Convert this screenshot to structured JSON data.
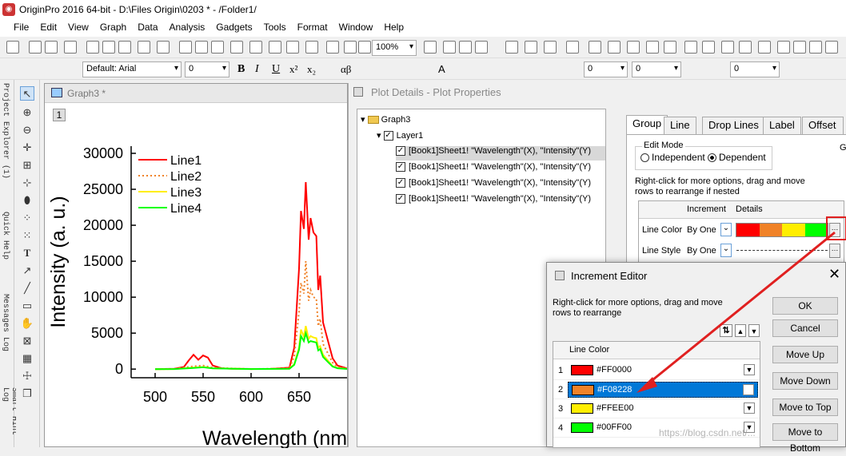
{
  "titlebar": {
    "text": "OriginPro 2016 64-bit - D:\\Files Origin\\0203 * - /Folder1/"
  },
  "menu": [
    "File",
    "Edit",
    "View",
    "Graph",
    "Data",
    "Analysis",
    "Gadgets",
    "Tools",
    "Format",
    "Window",
    "Help"
  ],
  "toolbar": {
    "zoom": "100%",
    "font": "Default: Arial",
    "font_size": "0",
    "size2": "0",
    "size3": "0",
    "size4": "0"
  },
  "side": {
    "project_explorer": "Project Explorer (1)",
    "quick_help": "Quick Help",
    "messages_log": "Messages Log",
    "smart_hint": "Smart Hint Log"
  },
  "graph": {
    "title": "Graph3 *",
    "layer_num": "1"
  },
  "chart_data": {
    "type": "line",
    "xlabel": "Wavelength (nm)",
    "ylabel": "Intensity (a. u.)",
    "xlim": [
      475,
      700
    ],
    "ylim": [
      -1200,
      31000
    ],
    "xticks": [
      "500",
      "550",
      "600",
      "650"
    ],
    "yticks": [
      "0",
      "5000",
      "10000",
      "15000",
      "20000",
      "25000",
      "30000"
    ],
    "series": [
      {
        "name": "Line1",
        "color": "#FF0000",
        "dash": "",
        "x": [
          500,
          520,
          530,
          535,
          540,
          545,
          550,
          555,
          560,
          570,
          580,
          600,
          620,
          640,
          645,
          650,
          652,
          655,
          657,
          660,
          662,
          665,
          668,
          670,
          672,
          675,
          680,
          685,
          690,
          700
        ],
        "y": [
          0,
          50,
          300,
          1200,
          2000,
          1300,
          1900,
          1600,
          500,
          100,
          50,
          20,
          30,
          200,
          3000,
          14000,
          22000,
          19500,
          26000,
          18000,
          21000,
          19000,
          18500,
          11000,
          13000,
          6500,
          4000,
          1500,
          500,
          100
        ]
      },
      {
        "name": "Line2",
        "color": "#F08228",
        "dash": "2,3",
        "x": [
          500,
          520,
          540,
          550,
          560,
          600,
          640,
          645,
          650,
          652,
          655,
          657,
          660,
          662,
          665,
          668,
          670,
          672,
          675,
          680,
          685,
          690,
          700
        ],
        "y": [
          0,
          20,
          400,
          500,
          200,
          10,
          100,
          1800,
          8000,
          12000,
          10500,
          15000,
          9500,
          11000,
          10000,
          9800,
          6000,
          7000,
          3500,
          2200,
          900,
          300,
          50
        ]
      },
      {
        "name": "Line3",
        "color": "#FFEE00",
        "dash": "",
        "x": [
          500,
          520,
          540,
          550,
          560,
          600,
          640,
          645,
          650,
          652,
          655,
          657,
          660,
          662,
          665,
          668,
          670,
          672,
          675,
          680,
          685,
          690,
          700
        ],
        "y": [
          0,
          10,
          200,
          300,
          120,
          5,
          50,
          700,
          3000,
          5500,
          4500,
          6000,
          4200,
          4600,
          4400,
          4300,
          3000,
          3200,
          2000,
          1200,
          400,
          150,
          30
        ]
      },
      {
        "name": "Line4",
        "color": "#00FF00",
        "dash": "",
        "x": [
          500,
          520,
          540,
          550,
          560,
          600,
          640,
          645,
          650,
          652,
          655,
          657,
          660,
          662,
          665,
          668,
          670,
          672,
          675,
          680,
          685,
          690,
          700
        ],
        "y": [
          0,
          8,
          150,
          250,
          100,
          5,
          40,
          600,
          2700,
          4600,
          3900,
          5000,
          3700,
          3900,
          3800,
          3700,
          2600,
          2800,
          1700,
          1000,
          350,
          120,
          20
        ]
      }
    ]
  },
  "plotdetails": {
    "title": "Plot Details - Plot Properties",
    "tree": {
      "root": "Graph3",
      "layer": "Layer1",
      "plots": [
        "[Book1]Sheet1! \"Wavelength\"(X), \"Intensity\"(Y)",
        "[Book1]Sheet1! \"Wavelength\"(X), \"Intensity\"(Y)",
        "[Book1]Sheet1! \"Wavelength\"(X), \"Intensity\"(Y)",
        "[Book1]Sheet1! \"Wavelength\"(X), \"Intensity\"(Y)"
      ]
    },
    "tabs": [
      "Group",
      "Line",
      "Drop Lines",
      "Label",
      "Offset"
    ],
    "edit_mode": {
      "label": "Edit Mode",
      "independent": "Independent",
      "dependent": "Dependent"
    },
    "hint": "Right-click for more options, drag and move rows to  rearrange if nested",
    "table": {
      "col_increment": "Increment",
      "col_details": "Details",
      "rows": [
        {
          "name": "Line Color",
          "increment": "By One"
        },
        {
          "name": "Line Style",
          "increment": "By One"
        }
      ]
    },
    "cut_letter": "G"
  },
  "increment_editor": {
    "title": "Increment Editor",
    "hint": "Right-click for more options, drag and move rows to  rearrange",
    "col_header": "Line Color",
    "rows": [
      {
        "num": "1",
        "hex": "#FF0000",
        "color": "#FF0000"
      },
      {
        "num": "2",
        "hex": "#F08228",
        "color": "#F08228"
      },
      {
        "num": "3",
        "hex": "#FFEE00",
        "color": "#FFEE00"
      },
      {
        "num": "4",
        "hex": "#00FF00",
        "color": "#00FF00"
      }
    ],
    "buttons": {
      "ok": "OK",
      "cancel": "Cancel",
      "move_up": "Move Up",
      "move_down": "Move Down",
      "move_top": "Move to Top",
      "move_bottom": "Move to Bottom"
    }
  },
  "watermark": "https://blog.csdn.net/..."
}
